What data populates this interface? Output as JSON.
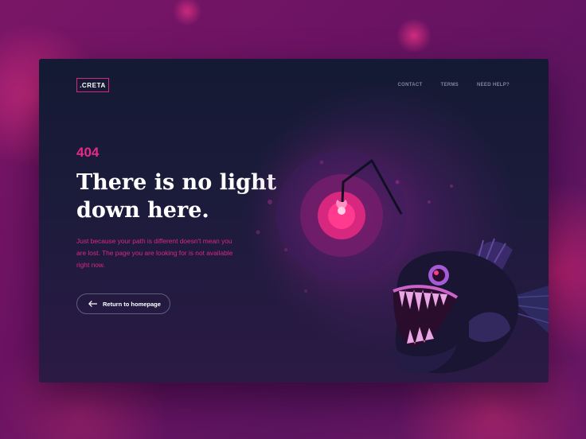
{
  "brand": {
    "logo": ".CRETA"
  },
  "nav": {
    "items": [
      "CONTACT",
      "TERMS",
      "NEED HELP?"
    ]
  },
  "error": {
    "code": "404",
    "headline": "There is no light down here.",
    "description": "Just because your path is different doesn't mean you are lost. The page you are looking for is not available right now."
  },
  "cta": {
    "label": "Return to homepage",
    "icon": "arrow-left-icon"
  },
  "colors": {
    "accent": "#e62a85",
    "card_background": "#141a33",
    "page_background": "#6b1363",
    "nav_text": "#7f84a3"
  }
}
